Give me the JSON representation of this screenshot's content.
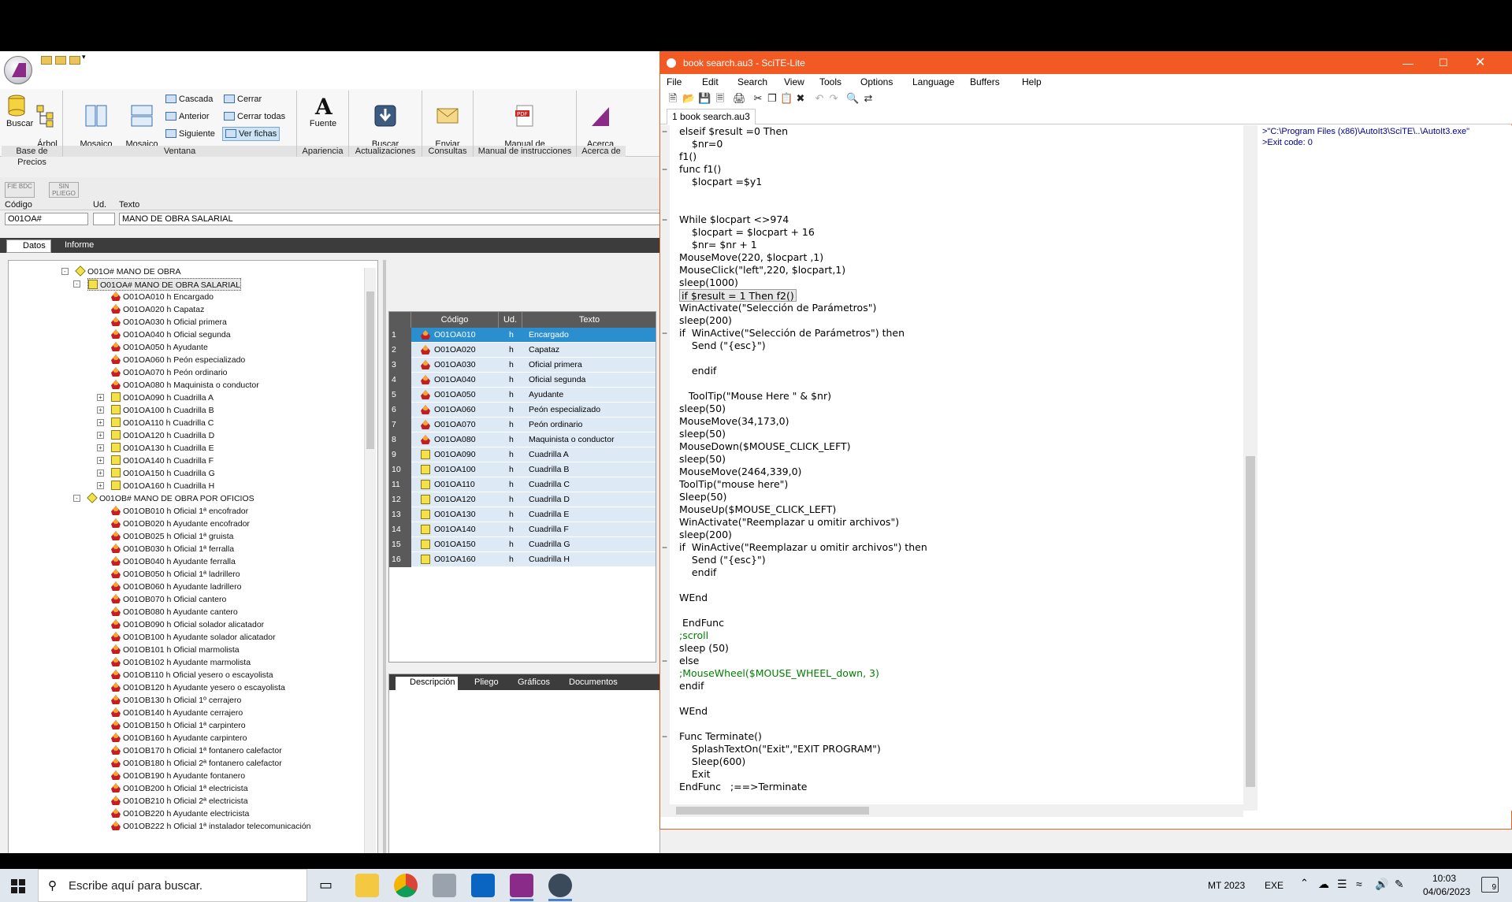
{
  "app": {
    "ribbon": {
      "buscar": "Buscar",
      "arbol_base": "Árbol\nbase",
      "mosaico_vertical": "Mosaico\nvertical",
      "mosaico_horizontal": "Mosaico\nhorizontal",
      "cascada": "Cascada",
      "anterior": "Anterior",
      "siguiente": "Siguiente",
      "cerrar": "Cerrar",
      "cerrar_todas": "Cerrar todas",
      "ver_fichas": "Ver fichas",
      "fuente": "Fuente",
      "buscar_actualizaciones": "Buscar\nactualizaciones",
      "enviar_consulta": "Enviar\nconsulta",
      "manual": "Manual de\ninstrucciones",
      "acerca": "Acerca\nde",
      "groups": {
        "base": "Base de Precios",
        "ventana": "Ventana",
        "apariencia": "Apariencia",
        "actualizaciones": "Actualizaciones",
        "consultas": "Consultas",
        "manual": "Manual de instrucciones",
        "acerca": "Acerca de"
      }
    },
    "tb_fie": "FIE BDC",
    "tb_sin": "SIN PLIEGO",
    "fields": {
      "codigo_label": "Código",
      "ud_label": "Ud.",
      "texto_label": "Texto",
      "codigo_value": "O01OA#",
      "ud_value": "",
      "texto_value": "MANO DE OBRA SALARIAL"
    },
    "tabs": {
      "datos": "Datos",
      "informe": "Informe"
    },
    "tree": [
      {
        "t": "O01O# MANO DE OBRA",
        "lvl": 0,
        "icon": "diamond",
        "exp": "-"
      },
      {
        "t": "O01OA# MANO DE OBRA SALARIAL",
        "lvl": 1,
        "icon": "folder",
        "exp": "-",
        "sel": true
      },
      {
        "t": "O01OA010 h Encargado",
        "lvl": 2,
        "icon": "person"
      },
      {
        "t": "O01OA020 h Capataz",
        "lvl": 2,
        "icon": "person"
      },
      {
        "t": "O01OA030 h Oficial primera",
        "lvl": 2,
        "icon": "person"
      },
      {
        "t": "O01OA040 h Oficial segunda",
        "lvl": 2,
        "icon": "person"
      },
      {
        "t": "O01OA050 h Ayudante",
        "lvl": 2,
        "icon": "person"
      },
      {
        "t": "O01OA060 h Peón especializado",
        "lvl": 2,
        "icon": "person"
      },
      {
        "t": "O01OA070 h Peón ordinario",
        "lvl": 2,
        "icon": "person"
      },
      {
        "t": "O01OA080 h Maquinista o conductor",
        "lvl": 2,
        "icon": "person"
      },
      {
        "t": "O01OA090 h Cuadrilla A",
        "lvl": 2,
        "icon": "folder",
        "exp": "+"
      },
      {
        "t": "O01OA100 h Cuadrilla B",
        "lvl": 2,
        "icon": "folder",
        "exp": "+"
      },
      {
        "t": "O01OA110 h Cuadrilla C",
        "lvl": 2,
        "icon": "folder",
        "exp": "+"
      },
      {
        "t": "O01OA120 h Cuadrilla D",
        "lvl": 2,
        "icon": "folder",
        "exp": "+"
      },
      {
        "t": "O01OA130 h Cuadrilla E",
        "lvl": 2,
        "icon": "folder",
        "exp": "+"
      },
      {
        "t": "O01OA140 h Cuadrilla F",
        "lvl": 2,
        "icon": "folder",
        "exp": "+"
      },
      {
        "t": "O01OA150 h Cuadrilla G",
        "lvl": 2,
        "icon": "folder",
        "exp": "+"
      },
      {
        "t": "O01OA160 h Cuadrilla H",
        "lvl": 2,
        "icon": "folder",
        "exp": "+"
      },
      {
        "t": "O01OB# MANO DE OBRA POR OFICIOS",
        "lvl": 1,
        "icon": "diamond",
        "exp": "-"
      },
      {
        "t": "O01OB010 h Oficial 1ª encofrador",
        "lvl": 2,
        "icon": "person"
      },
      {
        "t": "O01OB020 h Ayudante encofrador",
        "lvl": 2,
        "icon": "person"
      },
      {
        "t": "O01OB025 h Oficial 1ª gruista",
        "lvl": 2,
        "icon": "person"
      },
      {
        "t": "O01OB030 h Oficial 1ª ferralla",
        "lvl": 2,
        "icon": "person"
      },
      {
        "t": "O01OB040 h Ayudante ferralla",
        "lvl": 2,
        "icon": "person"
      },
      {
        "t": "O01OB050 h Oficial 1ª ladrillero",
        "lvl": 2,
        "icon": "person"
      },
      {
        "t": "O01OB060 h Ayudante ladrillero",
        "lvl": 2,
        "icon": "person"
      },
      {
        "t": "O01OB070 h Oficial cantero",
        "lvl": 2,
        "icon": "person"
      },
      {
        "t": "O01OB080 h Ayudante cantero",
        "lvl": 2,
        "icon": "person"
      },
      {
        "t": "O01OB090 h Oficial solador alicatador",
        "lvl": 2,
        "icon": "person"
      },
      {
        "t": "O01OB100 h Ayudante solador alicatador",
        "lvl": 2,
        "icon": "person"
      },
      {
        "t": "O01OB101 h Oficial marmolista",
        "lvl": 2,
        "icon": "person"
      },
      {
        "t": "O01OB102 h Ayudante marmolista",
        "lvl": 2,
        "icon": "person"
      },
      {
        "t": "O01OB110 h Oficial yesero o escayolista",
        "lvl": 2,
        "icon": "person"
      },
      {
        "t": "O01OB120 h Ayudante yesero o escayolista",
        "lvl": 2,
        "icon": "person"
      },
      {
        "t": "O01OB130 h Oficial 1º cerrajero",
        "lvl": 2,
        "icon": "person"
      },
      {
        "t": "O01OB140 h Ayudante cerrajero",
        "lvl": 2,
        "icon": "person"
      },
      {
        "t": "O01OB150 h Oficial 1ª carpintero",
        "lvl": 2,
        "icon": "person"
      },
      {
        "t": "O01OB160 h Ayudante carpintero",
        "lvl": 2,
        "icon": "person"
      },
      {
        "t": "O01OB170 h Oficial 1ª fontanero calefactor",
        "lvl": 2,
        "icon": "person"
      },
      {
        "t": "O01OB180 h Oficial 2ª fontanero calefactor",
        "lvl": 2,
        "icon": "person"
      },
      {
        "t": "O01OB190 h Ayudante fontanero",
        "lvl": 2,
        "icon": "person"
      },
      {
        "t": "O01OB200 h Oficial 1ª electricista",
        "lvl": 2,
        "icon": "person"
      },
      {
        "t": "O01OB210 h Oficial 2ª electricista",
        "lvl": 2,
        "icon": "person"
      },
      {
        "t": "O01OB220 h Ayudante electricista",
        "lvl": 2,
        "icon": "person"
      },
      {
        "t": "O01OB222 h Oficial 1ª instalador telecomunicación",
        "lvl": 2,
        "icon": "person"
      }
    ],
    "grid": {
      "headers": {
        "codigo": "Código",
        "ud": "Ud.",
        "texto": "Texto"
      },
      "rows": [
        {
          "n": "1",
          "c": "O01OA010",
          "u": "h",
          "t": "Encargado",
          "icon": "person",
          "sel": true
        },
        {
          "n": "2",
          "c": "O01OA020",
          "u": "h",
          "t": "Capataz",
          "icon": "person"
        },
        {
          "n": "3",
          "c": "O01OA030",
          "u": "h",
          "t": "Oficial primera",
          "icon": "person"
        },
        {
          "n": "4",
          "c": "O01OA040",
          "u": "h",
          "t": "Oficial segunda",
          "icon": "person"
        },
        {
          "n": "5",
          "c": "O01OA050",
          "u": "h",
          "t": "Ayudante",
          "icon": "person"
        },
        {
          "n": "6",
          "c": "O01OA060",
          "u": "h",
          "t": "Peón especializado",
          "icon": "person"
        },
        {
          "n": "7",
          "c": "O01OA070",
          "u": "h",
          "t": "Peón ordinario",
          "icon": "person"
        },
        {
          "n": "8",
          "c": "O01OA080",
          "u": "h",
          "t": "Maquinista o conductor",
          "icon": "person"
        },
        {
          "n": "9",
          "c": "O01OA090",
          "u": "h",
          "t": "Cuadrilla A",
          "icon": "folder"
        },
        {
          "n": "10",
          "c": "O01OA100",
          "u": "h",
          "t": "Cuadrilla B",
          "icon": "folder"
        },
        {
          "n": "11",
          "c": "O01OA110",
          "u": "h",
          "t": "Cuadrilla C",
          "icon": "folder"
        },
        {
          "n": "12",
          "c": "O01OA120",
          "u": "h",
          "t": "Cuadrilla D",
          "icon": "folder"
        },
        {
          "n": "13",
          "c": "O01OA130",
          "u": "h",
          "t": "Cuadrilla E",
          "icon": "folder"
        },
        {
          "n": "14",
          "c": "O01OA140",
          "u": "h",
          "t": "Cuadrilla F",
          "icon": "folder"
        },
        {
          "n": "15",
          "c": "O01OA150",
          "u": "h",
          "t": "Cuadrilla G",
          "icon": "folder"
        },
        {
          "n": "16",
          "c": "O01OA160",
          "u": "h",
          "t": "Cuadrilla H",
          "icon": "folder"
        }
      ]
    },
    "lower_tabs": {
      "descripcion": "Descripción",
      "pliego": "Pliego",
      "graficos": "Gráficos",
      "documentos": "Documentos"
    }
  },
  "scite": {
    "title": "book search.au3 - SciTE-Lite",
    "menu": [
      "File",
      "Edit",
      "Search",
      "View",
      "Tools",
      "Options",
      "Language",
      "Buffers",
      "Help"
    ],
    "tab": "1 book search.au3",
    "code": [
      {
        "f": "-",
        "s": "elseif $result =0 Then"
      },
      {
        "s": "    $nr=0"
      },
      {
        "s": "f1()"
      },
      {
        "f": "-",
        "s": "func f1()"
      },
      {
        "s": "    $locpart =$y1"
      },
      {
        "s": ""
      },
      {
        "s": ""
      },
      {
        "f": "-",
        "s": "While $locpart <>974"
      },
      {
        "s": "    $locpart = $locpart + 16"
      },
      {
        "s": "    $nr= $nr + 1"
      },
      {
        "s": "MouseMove(220, $locpart ,1)"
      },
      {
        "s": "MouseClick(\"left\",220, $locpart,1)"
      },
      {
        "s": "sleep(1000)"
      },
      {
        "s": "if $result = 1 Then f2()",
        "hl": true
      },
      {
        "s": "WinActivate(\"Selección de Parámetros\")"
      },
      {
        "s": "sleep(200)"
      },
      {
        "f": "-",
        "s": "if  WinActive(\"Selección de Parámetros\") then"
      },
      {
        "s": "    Send (\"{esc}\")"
      },
      {
        "s": ""
      },
      {
        "s": "    endif"
      },
      {
        "s": ""
      },
      {
        "s": "   ToolTip(\"Mouse Here \" & $nr)"
      },
      {
        "s": "sleep(50)"
      },
      {
        "s": "MouseMove(34,173,0)"
      },
      {
        "s": "sleep(50)"
      },
      {
        "s": "MouseDown($MOUSE_CLICK_LEFT)"
      },
      {
        "s": "sleep(50)"
      },
      {
        "s": "MouseMove(2464,339,0)"
      },
      {
        "s": "ToolTip(\"mouse here\")"
      },
      {
        "s": "Sleep(50)"
      },
      {
        "s": "MouseUp($MOUSE_CLICK_LEFT)"
      },
      {
        "s": "WinActivate(\"Reemplazar u omitir archivos\")"
      },
      {
        "s": "sleep(200)"
      },
      {
        "f": "-",
        "s": "if  WinActive(\"Reemplazar u omitir archivos\") then"
      },
      {
        "s": "    Send (\"{esc}\")"
      },
      {
        "s": "    endif"
      },
      {
        "s": ""
      },
      {
        "s": "WEnd"
      },
      {
        "s": ""
      },
      {
        "s": " EndFunc"
      },
      {
        "s": ";scroll"
      },
      {
        "s": "sleep (50)"
      },
      {
        "f": "-",
        "s": "else"
      },
      {
        "s": ";MouseWheel($MOUSE_WHEEL_down, 3)"
      },
      {
        "s": "endif"
      },
      {
        "s": ""
      },
      {
        "s": "WEnd"
      },
      {
        "s": ""
      },
      {
        "f": "-",
        "s": "Func Terminate()"
      },
      {
        "s": "    SplashTextOn(\"Exit\",\"EXIT PROGRAM\")"
      },
      {
        "s": "    Sleep(600)"
      },
      {
        "s": "    Exit"
      },
      {
        "s": "EndFunc   ;==>Terminate"
      }
    ],
    "output": [
      ">\"C:\\Program Files (x86)\\AutoIt3\\SciTE\\..\\AutoIt3.exe\"",
      ">Exit code: 0"
    ]
  },
  "taskbar": {
    "search_placeholder": "Escribe aquí para buscar.",
    "mt": "MT 2023",
    "exe": "EXE",
    "time": "10:03",
    "date": "04/06/2023",
    "notif": "9"
  }
}
